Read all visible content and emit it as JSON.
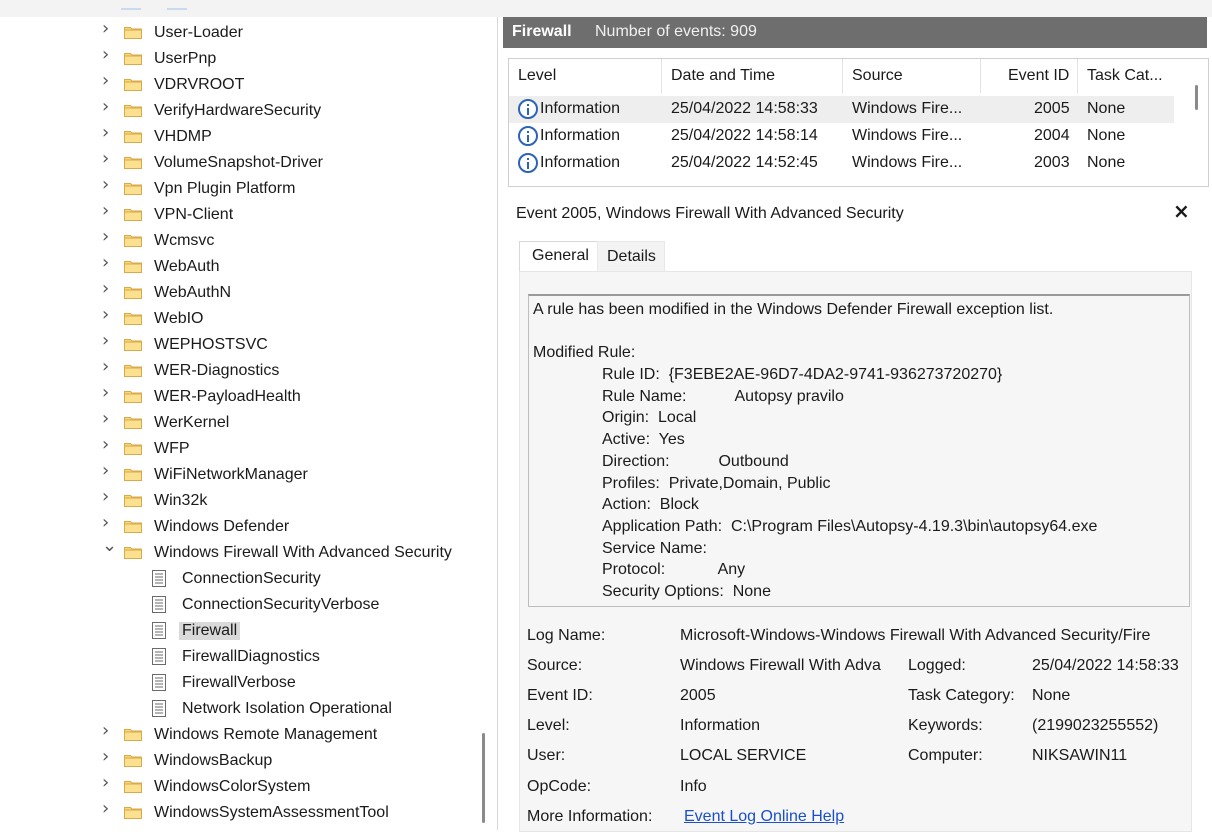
{
  "tree": {
    "items": [
      {
        "label": "User-Loader",
        "kind": "folder",
        "expanded": false
      },
      {
        "label": "UserPnp",
        "kind": "folder",
        "expanded": false
      },
      {
        "label": "VDRVROOT",
        "kind": "folder",
        "expanded": false
      },
      {
        "label": "VerifyHardwareSecurity",
        "kind": "folder",
        "expanded": false
      },
      {
        "label": "VHDMP",
        "kind": "folder",
        "expanded": false
      },
      {
        "label": "VolumeSnapshot-Driver",
        "kind": "folder",
        "expanded": false
      },
      {
        "label": "Vpn Plugin Platform",
        "kind": "folder",
        "expanded": false
      },
      {
        "label": "VPN-Client",
        "kind": "folder",
        "expanded": false
      },
      {
        "label": "Wcmsvc",
        "kind": "folder",
        "expanded": false
      },
      {
        "label": "WebAuth",
        "kind": "folder",
        "expanded": false
      },
      {
        "label": "WebAuthN",
        "kind": "folder",
        "expanded": false
      },
      {
        "label": "WebIO",
        "kind": "folder",
        "expanded": false
      },
      {
        "label": "WEPHOSTSVC",
        "kind": "folder",
        "expanded": false
      },
      {
        "label": "WER-Diagnostics",
        "kind": "folder",
        "expanded": false
      },
      {
        "label": "WER-PayloadHealth",
        "kind": "folder",
        "expanded": false
      },
      {
        "label": "WerKernel",
        "kind": "folder",
        "expanded": false
      },
      {
        "label": "WFP",
        "kind": "folder",
        "expanded": false
      },
      {
        "label": "WiFiNetworkManager",
        "kind": "folder",
        "expanded": false
      },
      {
        "label": "Win32k",
        "kind": "folder",
        "expanded": false
      },
      {
        "label": "Windows Defender",
        "kind": "folder",
        "expanded": false
      },
      {
        "label": "Windows Firewall With Advanced Security",
        "kind": "folder",
        "expanded": true
      },
      {
        "label": "ConnectionSecurity",
        "kind": "log"
      },
      {
        "label": "ConnectionSecurityVerbose",
        "kind": "log"
      },
      {
        "label": "Firewall",
        "kind": "log",
        "selected": true
      },
      {
        "label": "FirewallDiagnostics",
        "kind": "log"
      },
      {
        "label": "FirewallVerbose",
        "kind": "log"
      },
      {
        "label": "Network Isolation Operational",
        "kind": "log"
      },
      {
        "label": "Windows Remote Management",
        "kind": "folder",
        "expanded": false
      },
      {
        "label": "WindowsBackup",
        "kind": "folder",
        "expanded": false
      },
      {
        "label": "WindowsColorSystem",
        "kind": "folder",
        "expanded": false
      },
      {
        "label": "WindowsSystemAssessmentTool",
        "kind": "folder",
        "expanded": false
      }
    ]
  },
  "header": {
    "title": "Firewall",
    "count": "Number of events: 909"
  },
  "events": {
    "columns": [
      "Level",
      "Date and Time",
      "Source",
      "Event ID",
      "Task Cat..."
    ],
    "rows": [
      {
        "level": "Information",
        "date": "25/04/2022 14:58:33",
        "source": "Windows Fire...",
        "id": "2005",
        "task": "None",
        "selected": true
      },
      {
        "level": "Information",
        "date": "25/04/2022 14:58:14",
        "source": "Windows Fire...",
        "id": "2004",
        "task": "None"
      },
      {
        "level": "Information",
        "date": "25/04/2022 14:52:45",
        "source": "Windows Fire...",
        "id": "2003",
        "task": "None"
      }
    ]
  },
  "detail": {
    "title": "Event 2005, Windows Firewall With Advanced Security",
    "close": "×",
    "tabs": [
      "General",
      "Details"
    ],
    "message": {
      "intro": "A rule has been modified in the Windows Defender Firewall exception list.",
      "heading": "Modified Rule:",
      "lines": [
        "Rule ID:  {F3EBE2AE-96D7-4DA2-9741-936273720270}",
        "Rule Name:           Autopsy pravilo",
        "Origin:  Local",
        "Active:  Yes",
        "Direction:           Outbound",
        "Profiles:  Private,Domain, Public",
        "Action:  Block",
        "Application Path:  C:\\Program Files\\Autopsy-4.19.3\\bin\\autopsy64.exe",
        "Service Name:",
        "Protocol:            Any",
        "Security Options:  None"
      ]
    },
    "meta": {
      "log_name_k": "Log Name:",
      "log_name_v": "Microsoft-Windows-Windows Firewall With Advanced Security/Fire",
      "source_k": "Source:",
      "source_v": "Windows Firewall With Adva",
      "logged_k": "Logged:",
      "logged_v": "25/04/2022 14:58:33",
      "event_id_k": "Event ID:",
      "event_id_v": "2005",
      "task_k": "Task Category:",
      "task_v": "None",
      "level_k": "Level:",
      "level_v": "Information",
      "keywords_k": "Keywords:",
      "keywords_v": "(2199023255552)",
      "user_k": "User:",
      "user_v": "LOCAL SERVICE",
      "computer_k": "Computer:",
      "computer_v": "NIKSAWIN11",
      "opcode_k": "OpCode:",
      "opcode_v": "Info",
      "more_k": "More Information:",
      "more_v": "Event Log Online Help"
    }
  }
}
